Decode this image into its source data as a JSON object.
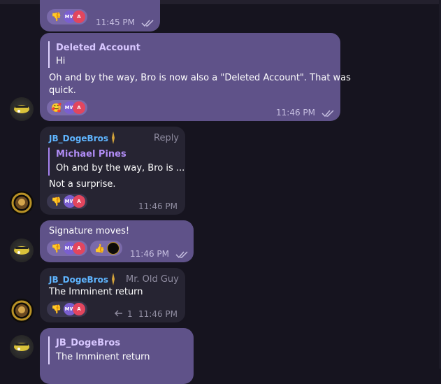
{
  "messages": [
    {
      "id": "m1",
      "time": "11:45 PM"
    },
    {
      "id": "m2",
      "reply_name": "Deleted Account",
      "reply_text": "Hi",
      "text_line1": "Oh and by the way, Bro is now also a \"Deleted Account\". That was",
      "text_line2": "quick.",
      "time": "11:46 PM"
    },
    {
      "id": "m3",
      "sender": "JB_DogeBros",
      "reply_label": "Reply",
      "reply_name": "Michael Pines",
      "reply_text": "Oh and by the way, Bro is ...",
      "text": "Not a surprise.",
      "time": "11:46 PM"
    },
    {
      "id": "m4",
      "text": "Signature moves!",
      "time": "11:46 PM"
    },
    {
      "id": "m5",
      "sender": "JB_DogeBros",
      "sender_title": "Mr. Old Guy",
      "text": "The Imminent return",
      "replies_count": "1",
      "time": "11:46 PM"
    },
    {
      "id": "m6",
      "reply_name": "JB_DogeBros",
      "reply_text": "The Imminent return"
    }
  ],
  "reaction_avatars": {
    "mw": "MW",
    "a": "A"
  },
  "reactions": {
    "thumbs_down": "👎",
    "hug": "🥰",
    "thumbs_up": "👍"
  },
  "icons": [
    "thumbs-down-icon",
    "heart-face-icon",
    "thumbs-up-icon",
    "double-check-icon",
    "reply-arrow-icon",
    "gold-token-icon"
  ],
  "colors": {
    "background": "#16141f",
    "outgoing_bubble": "#5f5289",
    "incoming_bubble": "#262432",
    "sender_name": "#5fb5ff",
    "reply_name_out": "#d8c7ff",
    "reply_name_in": "#b08cf5"
  }
}
